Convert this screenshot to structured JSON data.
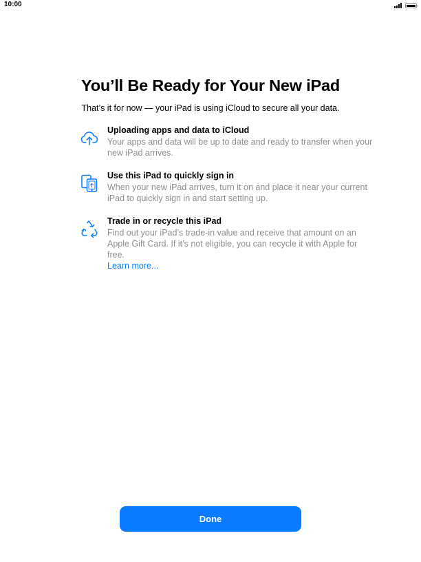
{
  "status_bar": {
    "time": "10:00"
  },
  "page": {
    "title": "You’ll Be Ready for Your New iPad",
    "subtitle": "That’s it for now — your iPad is using iCloud to secure all your data."
  },
  "features": [
    {
      "icon": "icloud-upload-icon",
      "title": "Uploading apps and data to iCloud",
      "description": "Your apps and data will be up to date and ready to transfer when your new iPad arrives."
    },
    {
      "icon": "ipad-transfer-icon",
      "title": "Use this iPad to quickly sign in",
      "description": "When your new iPad arrives, turn it on and place it near your current iPad to quickly sign in and start setting up."
    },
    {
      "icon": "recycle-icon",
      "title": "Trade in or recycle this iPad",
      "description": "Find out your iPad’s trade-in value and receive that amount on an Apple Gift Card. If it’s not eligible, you can recycle it with Apple for free.",
      "link": "Learn more..."
    }
  ],
  "actions": {
    "done_label": "Done"
  },
  "colors": {
    "accent": "#0a7aff",
    "secondary_text": "#8e8e93"
  }
}
